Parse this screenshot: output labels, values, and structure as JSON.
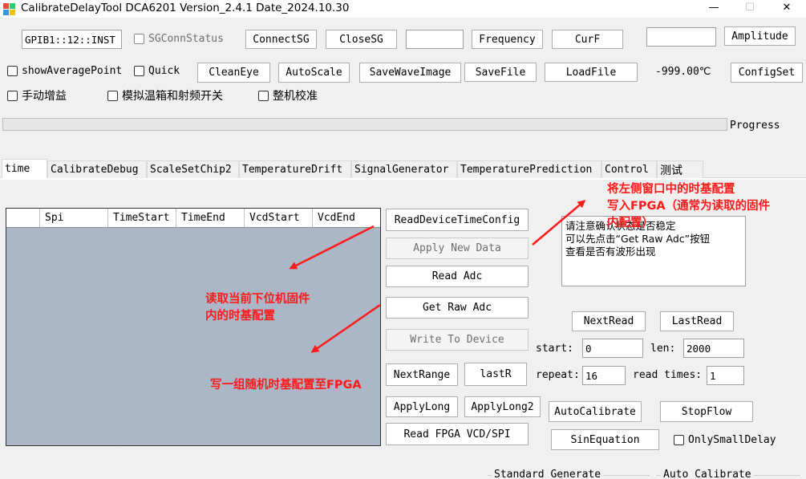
{
  "window": {
    "title": "CalibrateDelayTool DCA6201 Version_2.4.1 Date_2024.10.30",
    "minimize_glyph": "—",
    "maximize_glyph": "☐",
    "close_glyph": "✕"
  },
  "toolbar": {
    "gpib_value": "GPIB1::12::INST",
    "sg_conn_status_label": "SGConnStatus",
    "connect_sg_label": "ConnectSG",
    "close_sg_label": "CloseSG",
    "sg_value_box": "",
    "frequency_label": "Frequency",
    "curf_label": "CurF",
    "amplitude_box": "",
    "amplitude_label": "Amplitude",
    "show_average_point_label": "showAveragePoint",
    "quick_label": "Quick",
    "clean_eye_label": "CleanEye",
    "auto_scale_label": "AutoScale",
    "save_wave_image_label": "SaveWaveImage",
    "save_file_label": "SaveFile",
    "load_file_label": "LoadFile",
    "temperature_readout": "-999.00℃",
    "config_set_label": "ConfigSet",
    "manual_gain_label": "手动增益",
    "simulate_label": "模拟温箱和射频开关",
    "whole_calib_label": "整机校准",
    "progress_label": "Progress",
    "progress_value": 0
  },
  "tabs": [
    {
      "label": "time",
      "active": true
    },
    {
      "label": "CalibrateDebug"
    },
    {
      "label": "ScaleSetChip2"
    },
    {
      "label": "TemperatureDrift"
    },
    {
      "label": "SignalGenerator"
    },
    {
      "label": "TemperaturePrediction"
    },
    {
      "label": "Control"
    },
    {
      "label": "测试"
    }
  ],
  "grid": {
    "columns": [
      "Spi",
      "TimeStart",
      "TimeEnd",
      "VcdStart",
      "VcdEnd"
    ]
  },
  "actions": {
    "read_device_time_config": "ReadDeviceTimeConfig",
    "apply_new_data": "Apply New Data",
    "read_adc": "Read Adc",
    "get_raw_adc": "Get Raw Adc",
    "write_to_device": "Write To Device",
    "next_range": "NextRange",
    "last_r": "lastR",
    "apply_long": "ApplyLong",
    "apply_long2": "ApplyLong2",
    "read_fpga_vcd_spi": "Read FPGA VCD/SPI"
  },
  "info_text": {
    "line1": "请注意确认状态是否稳定",
    "line2": "可以先点击“Get Raw Adc”按钮",
    "line3": "查看是否有波形出现"
  },
  "read_controls": {
    "next_read": "NextRead",
    "last_read": "LastRead",
    "start_label": "start:",
    "start_value": "0",
    "len_label": "len:",
    "len_value": "2000",
    "repeat_label": "repeat:",
    "repeat_value": "16",
    "read_times_label": "read times:",
    "read_times_value": "1",
    "auto_calibrate": "AutoCalibrate",
    "stop_flow": "StopFlow",
    "sin_equation": "SinEquation",
    "only_small_delay": "OnlySmallDelay",
    "standard_generate": "Standard Generate",
    "auto_calibrate_group": "Auto Calibrate"
  },
  "annotations": {
    "top_right_1": "将左侧窗口中的时基配置",
    "top_right_2": "写入FPGA（通常为读取的固件",
    "top_right_3": "内配置）",
    "middle_1": "读取当前下位机固件",
    "middle_2": "内的时基配置",
    "bottom": "写一组随机时基配置至FPGA"
  },
  "colors": {
    "annotation": "#ff1a1a",
    "grid_background": "#abb6c7",
    "window_background": "#f0f0f0"
  }
}
